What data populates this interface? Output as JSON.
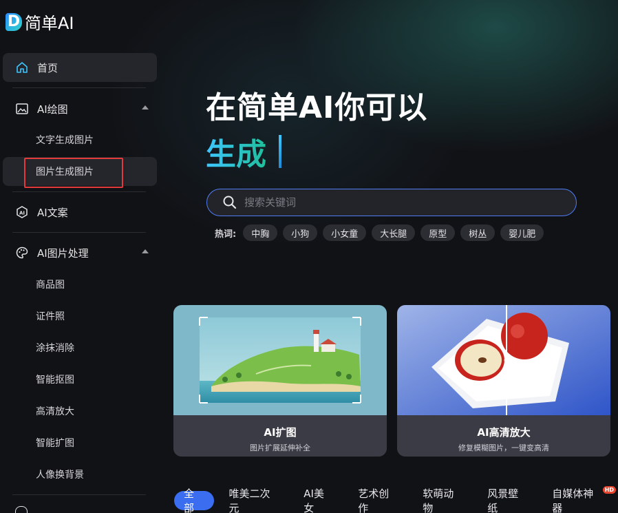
{
  "app": {
    "logo_letter": "D",
    "title": "简单AI"
  },
  "sidebar": {
    "home": "首页",
    "ai_drawing": "AI绘图",
    "ai_drawing_items": [
      "文字生成图片",
      "图片生成图片"
    ],
    "ai_copywriting": "AI文案",
    "ai_image_processing": "AI图片处理",
    "ai_image_items": [
      "商品图",
      "证件照",
      "涂抹消除",
      "智能抠图",
      "高清放大",
      "智能扩图",
      "人像换背景"
    ]
  },
  "hero": {
    "title": "在简单AI你可以",
    "subtitle": "生成"
  },
  "search": {
    "placeholder": "搜索关键词"
  },
  "hot": {
    "label": "热词:",
    "tags": [
      "中胸",
      "小狗",
      "小女童",
      "大长腿",
      "原型",
      "树丛",
      "婴儿肥"
    ]
  },
  "cards": [
    {
      "title": "AI扩图",
      "desc": "图片扩展延伸补全"
    },
    {
      "title": "AI高清放大",
      "desc": "修复模糊图片，一键变高清"
    }
  ],
  "categories": {
    "items": [
      "全部",
      "唯美二次元",
      "AI美女",
      "艺术创作",
      "软萌动物",
      "风景壁纸",
      "自媒体神器"
    ],
    "active_index": 0,
    "badge": "HD"
  },
  "colors": {
    "accent": "#3a6df0",
    "search_border": "#4f7df5",
    "highlight_box": "#e23b3b"
  }
}
